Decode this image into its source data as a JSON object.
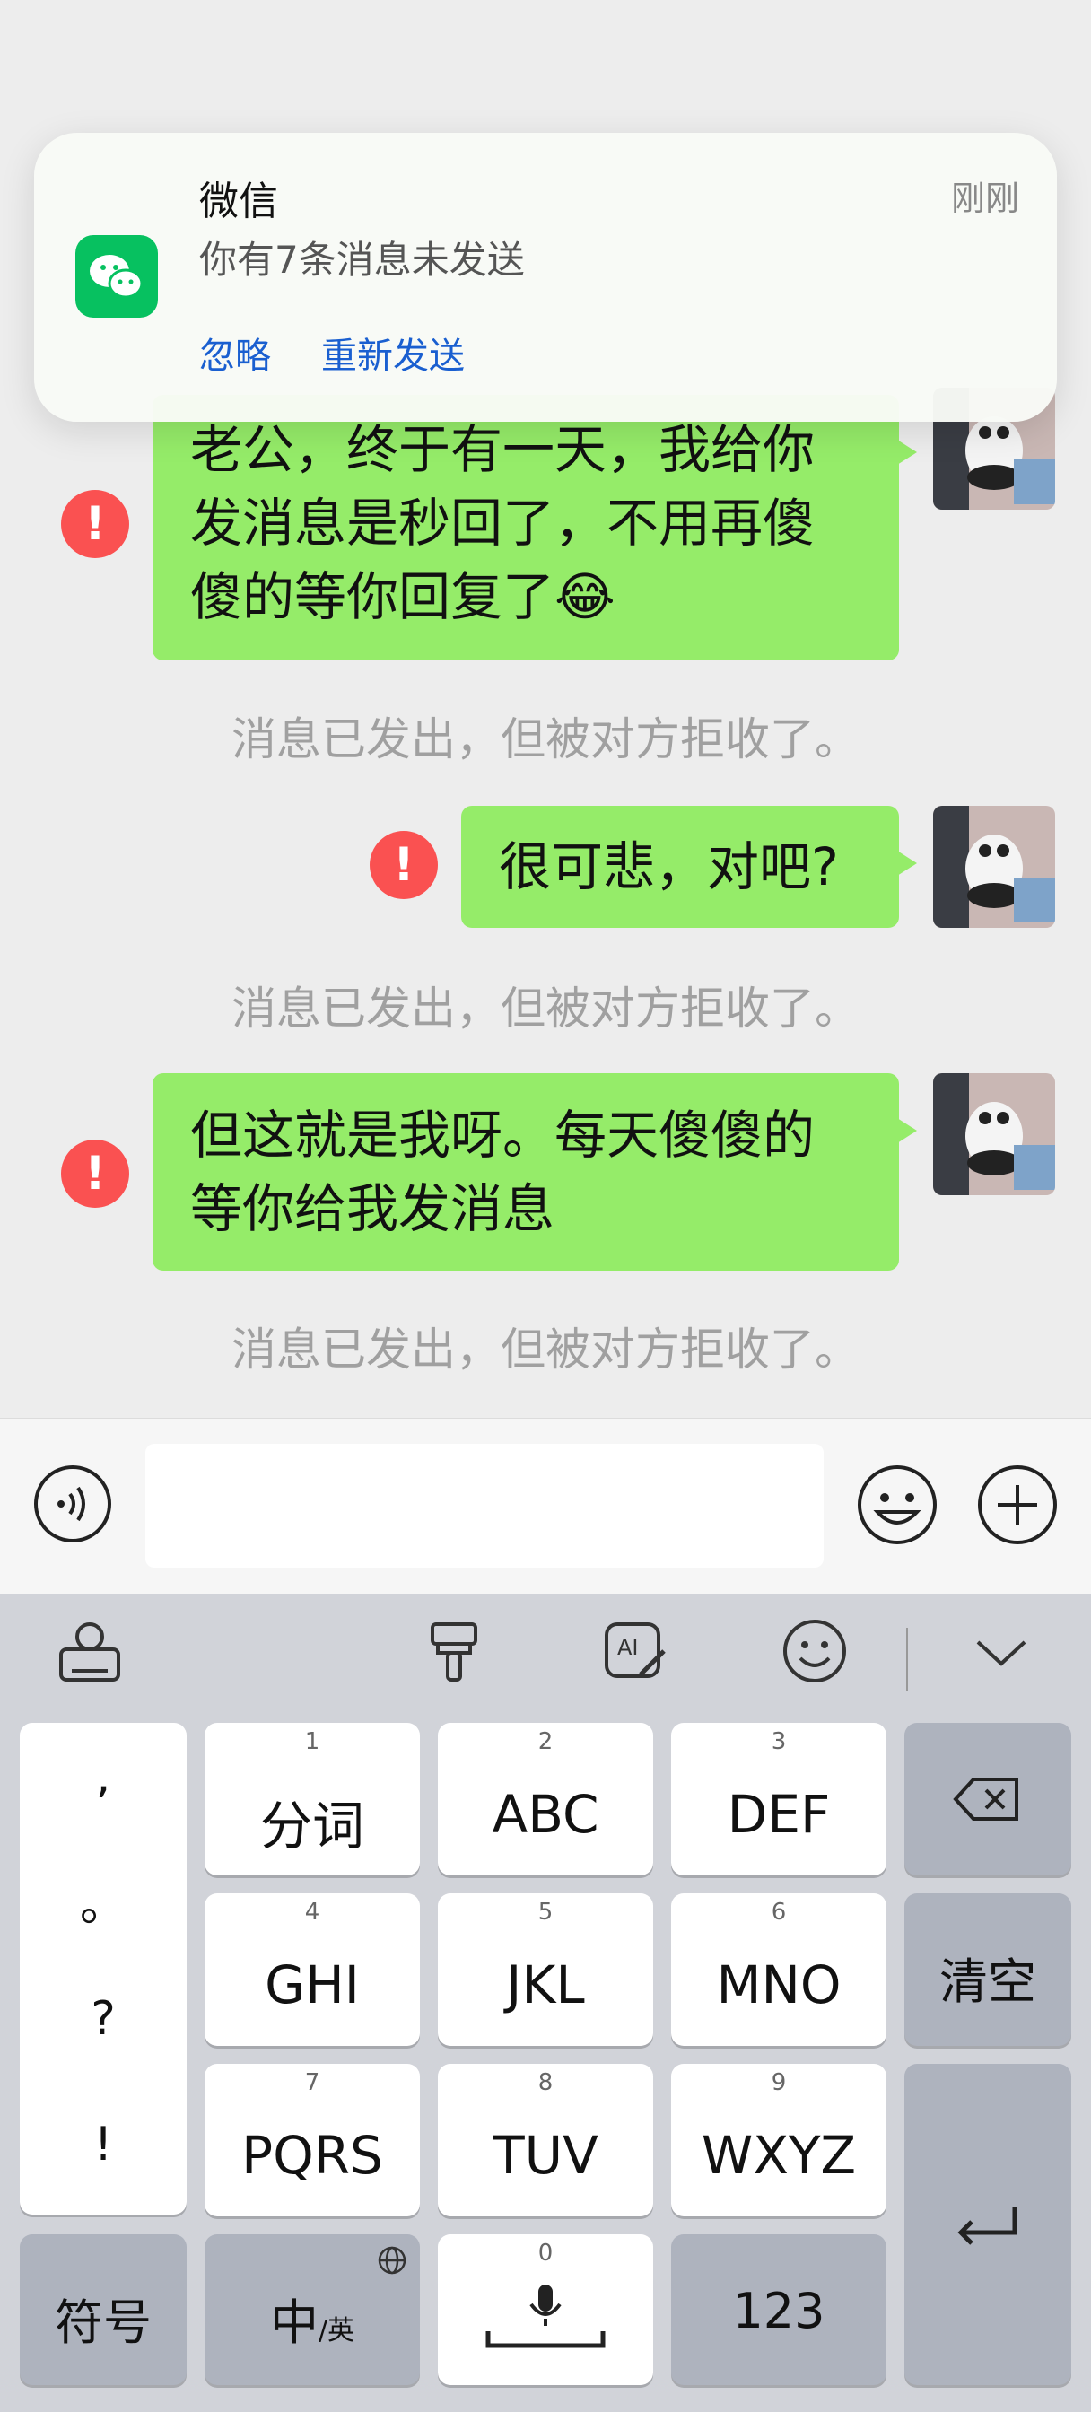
{
  "notification": {
    "app_name": "微信",
    "time": "刚刚",
    "message": "你有7条消息未发送",
    "action_ignore": "忽略",
    "action_resend": "重新发送"
  },
  "messages": [
    {
      "lines": [
        "老公，终于有一天，我给你",
        "发消息是秒回了，不用再傻",
        "傻的等你回复了"
      ],
      "emoji": "😂",
      "status": "消息已发出，但被对方拒收了。"
    },
    {
      "lines": [
        "很可悲，对吧?"
      ],
      "status": "消息已发出，但被对方拒收了。"
    },
    {
      "lines": [
        "但这就是我呀。每天傻傻的",
        "等你给我发消息"
      ],
      "status": "消息已发出，但被对方拒收了。"
    }
  ],
  "error_mark": "!",
  "input": {
    "value": ""
  },
  "keyboard": {
    "punct": [
      ",",
      "。",
      "?",
      "!"
    ],
    "keys": [
      {
        "num": "1",
        "label": "分词"
      },
      {
        "num": "2",
        "label": "ABC"
      },
      {
        "num": "3",
        "label": "DEF"
      },
      {
        "num": "4",
        "label": "GHI"
      },
      {
        "num": "5",
        "label": "JKL"
      },
      {
        "num": "6",
        "label": "MNO"
      },
      {
        "num": "7",
        "label": "PQRS"
      },
      {
        "num": "8",
        "label": "TUV"
      },
      {
        "num": "9",
        "label": "WXYZ"
      }
    ],
    "clear": "清空",
    "symbols": "符号",
    "lang_main": "中",
    "lang_sub": "/英",
    "space_num": "0",
    "numbers": "123"
  },
  "colors": {
    "bubble": "#95ec69",
    "error": "#fa5151",
    "link": "#1a5fd0",
    "wechat": "#07c160"
  }
}
